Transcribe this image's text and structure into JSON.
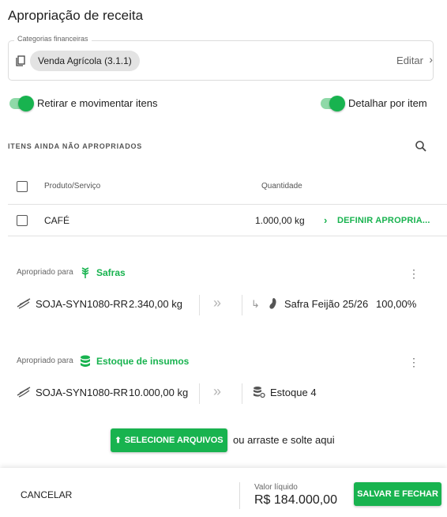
{
  "page": {
    "title": "Apropriação de receita"
  },
  "categories": {
    "legend": "Categorias financeiras",
    "chip": "Venda Agrícola (3.1.1)",
    "edit_label": "Editar",
    "edit_chevron": "›"
  },
  "toggles": {
    "retirar": {
      "label": "Retirar e movimentar itens",
      "on": true
    },
    "detalhar": {
      "label": "Detalhar por item",
      "on": true
    }
  },
  "unallocated": {
    "heading": "ITENS AINDA NÃO APROPRIADOS",
    "columns": {
      "product": "Produto/Serviço",
      "quantity": "Quantidade"
    },
    "rows": [
      {
        "product": "CAFÉ",
        "quantity": "1.000,00 kg",
        "action_chevron": "›",
        "action": "DEFINIR APROPRIA..."
      }
    ]
  },
  "allocations": [
    {
      "label": "Apropriado para",
      "destination": "Safras",
      "dest_icon": "wheat-icon",
      "kebab": "⋮",
      "item": "SOJA-SYN1080-RR",
      "quantity": "2.340,00 kg",
      "arrows": "»",
      "sub_arrow": "↳",
      "target": "Safra Feijão 25/26",
      "percent": "100,00%"
    },
    {
      "label": "Apropriado para",
      "destination": "Estoque de insumos",
      "dest_icon": "database-icon",
      "kebab": "⋮",
      "item": "SOJA-SYN1080-RR",
      "quantity": "10.000,00 kg",
      "arrows": "»",
      "target": "Estoque 4"
    }
  ],
  "upload": {
    "button": "SELECIONE ARQUIVOS",
    "button_icon": "⬆",
    "hint": "ou arraste e solte aqui"
  },
  "footer": {
    "cancel": "CANCELAR",
    "net_label": "Valor líquido",
    "net_value": "R$ 184.000,00",
    "save": "SALVAR E FECHAR"
  },
  "colors": {
    "accent": "#18b34f",
    "accent_light": "#8fd9a8"
  }
}
